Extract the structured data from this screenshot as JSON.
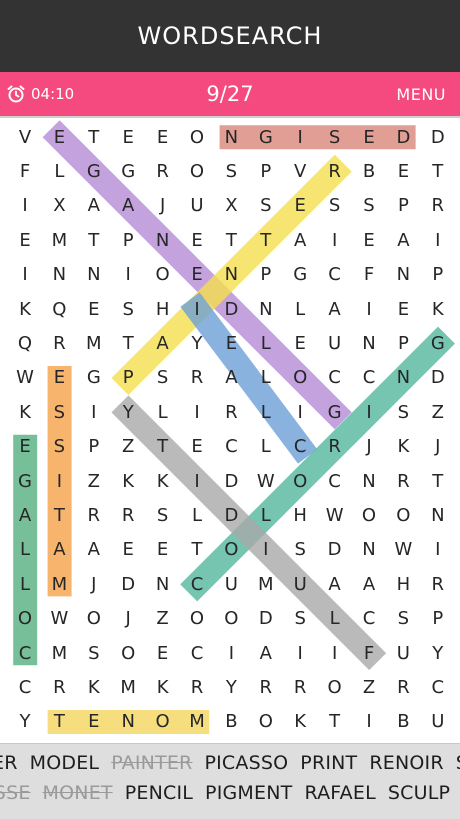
{
  "app": {
    "title": "WORDSEARCH"
  },
  "status": {
    "timer": "04:10",
    "progress": "9/27",
    "menu_label": "MENU"
  },
  "grid": {
    "rows": [
      "VETEEONGISEDD",
      "FLGGROSPVRBET",
      "IXAAJUXSESSPR",
      "EMTPNETTAIEAI",
      "INNIOENPGCFNP",
      "KQESHIDNLAIEK",
      "QRMTAYELEUNPG",
      "WEGPSRALOCCND",
      "KSIYLIRLIGISZ",
      "ESPZTECLCRJKJ",
      "GIZKKIDWOCNRT",
      "ATRRSLDLHWOON",
      "LAAEETOISDNWI",
      "LMJDNCUMUAAHR",
      "OWOJZOODSLCSP",
      "CMSOECIAIIFUY",
      "CRKMKRYRROZRC",
      "YTENOMBOKTIBU"
    ]
  },
  "found_words": [
    {
      "word": "DESIGN",
      "color": "#d9877a",
      "start": [
        0,
        11
      ],
      "end": [
        0,
        6
      ]
    },
    {
      "word": "EDITOR",
      "color": "#b58bd6",
      "start": [
        0,
        1
      ],
      "end": [
        8,
        9
      ]
    },
    {
      "word": "PORTRAIT",
      "color": "#f5e04e",
      "start": [
        7,
        3
      ],
      "end": [
        1,
        9
      ]
    },
    {
      "word": "COLOR",
      "color": "#6e9fd6",
      "start": [
        9,
        8
      ],
      "end": [
        5,
        5
      ]
    },
    {
      "word": "CUBISM",
      "color": "#55b79e",
      "start": [
        13,
        5
      ],
      "end": [
        6,
        12
      ]
    },
    {
      "word": "SKETCH",
      "color": "#a9a9a9",
      "start": [
        8,
        3
      ],
      "end": [
        15,
        10
      ]
    },
    {
      "word": "MONET",
      "color": "#f5d75e",
      "start": [
        17,
        5
      ],
      "end": [
        17,
        1
      ]
    },
    {
      "word": "MATISSE",
      "color": "#f4a248",
      "start": [
        13,
        1
      ],
      "end": [
        7,
        1
      ]
    },
    {
      "word": "COLLAGE",
      "color": "#55b080",
      "start": [
        15,
        0
      ],
      "end": [
        9,
        0
      ]
    }
  ],
  "word_list": {
    "row1": [
      {
        "text": "ER",
        "found": false
      },
      {
        "text": "MODEL",
        "found": false
      },
      {
        "text": "PAINTER",
        "found": true
      },
      {
        "text": "PICASSO",
        "found": false
      },
      {
        "text": "PRINT",
        "found": false
      },
      {
        "text": "RENOIR",
        "found": false
      },
      {
        "text": "S",
        "found": false
      }
    ],
    "row2": [
      {
        "text": "ISSE",
        "found": true
      },
      {
        "text": "MONET",
        "found": true
      },
      {
        "text": "PENCIL",
        "found": false
      },
      {
        "text": "PIGMENT",
        "found": false
      },
      {
        "text": "RAFAEL",
        "found": false
      },
      {
        "text": "SCULP",
        "found": false
      }
    ]
  }
}
